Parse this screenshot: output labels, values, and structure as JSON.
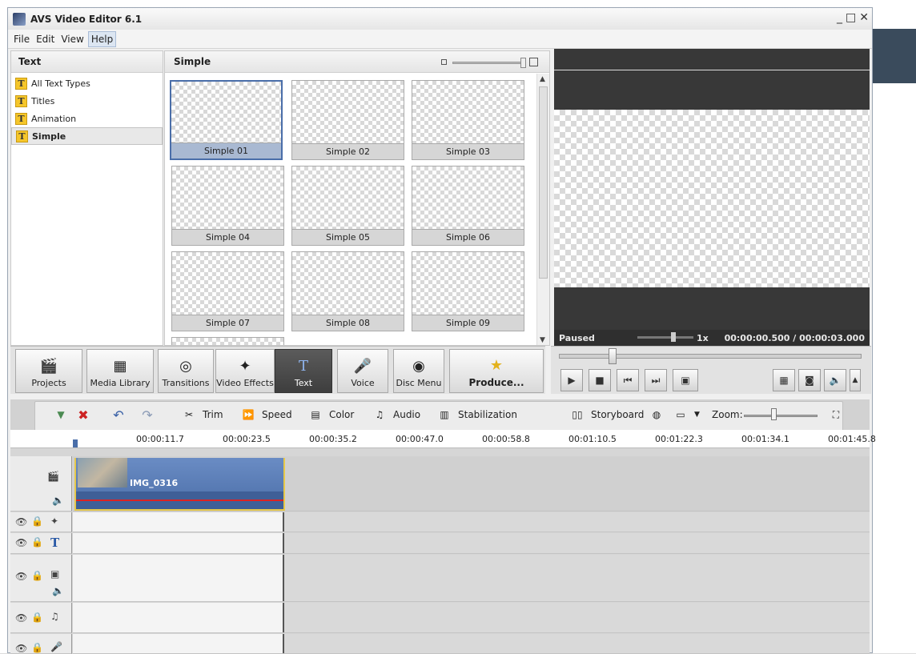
{
  "window": {
    "title": "AVS Video Editor 6.1",
    "minimize": "_",
    "maximize": "□",
    "close": "✕"
  },
  "menu": [
    {
      "label": "File"
    },
    {
      "label": "Edit"
    },
    {
      "label": "View"
    },
    {
      "label": "Help"
    }
  ],
  "left_panel": {
    "header": "Text",
    "items": [
      {
        "label": "All Text Types"
      },
      {
        "label": "Titles"
      },
      {
        "label": "Animation"
      },
      {
        "label": "Simple"
      }
    ]
  },
  "gallery": {
    "header": "Simple",
    "tiles": [
      {
        "label": "Simple 01"
      },
      {
        "label": "Simple 02"
      },
      {
        "label": "Simple 03"
      },
      {
        "label": "Simple 04"
      },
      {
        "label": "Simple 05"
      },
      {
        "label": "Simple 06"
      },
      {
        "label": "Simple 07"
      },
      {
        "label": "Simple 08"
      },
      {
        "label": "Simple 09"
      }
    ]
  },
  "preview": {
    "status": "Paused",
    "speed": "1x",
    "time": "00:00:00.500 / 00:00:03.000"
  },
  "main_tools": [
    {
      "label": "Projects",
      "icon": "clapperboard-icon"
    },
    {
      "label": "Media Library",
      "icon": "film-icon"
    },
    {
      "label": "Transitions",
      "icon": "swirl-icon"
    },
    {
      "label": "Video Effects",
      "icon": "effects-icon"
    },
    {
      "label": "Text",
      "icon": "text-icon"
    },
    {
      "label": "Voice",
      "icon": "microphone-icon"
    },
    {
      "label": "Disc Menu",
      "icon": "disc-icon"
    },
    {
      "label": "Produce...",
      "icon": "produce-icon"
    }
  ],
  "timeline_tools": {
    "trim": "Trim",
    "speed": "Speed",
    "color": "Color",
    "audio": "Audio",
    "stabilization": "Stabilization",
    "storyboard": "Storyboard",
    "zoom": "Zoom:"
  },
  "ruler": [
    "00:00:11.7",
    "00:00:23.5",
    "00:00:35.2",
    "00:00:47.0",
    "00:00:58.8",
    "00:01:10.5",
    "00:01:22.3",
    "00:01:34.1",
    "00:01:45.8"
  ],
  "clip": {
    "name": "IMG_0316"
  },
  "colors": {
    "accent": "#4a6ea9",
    "clip": "#5a7cb8",
    "clip_border": "#e6c84a",
    "waveline": "#d22222"
  }
}
